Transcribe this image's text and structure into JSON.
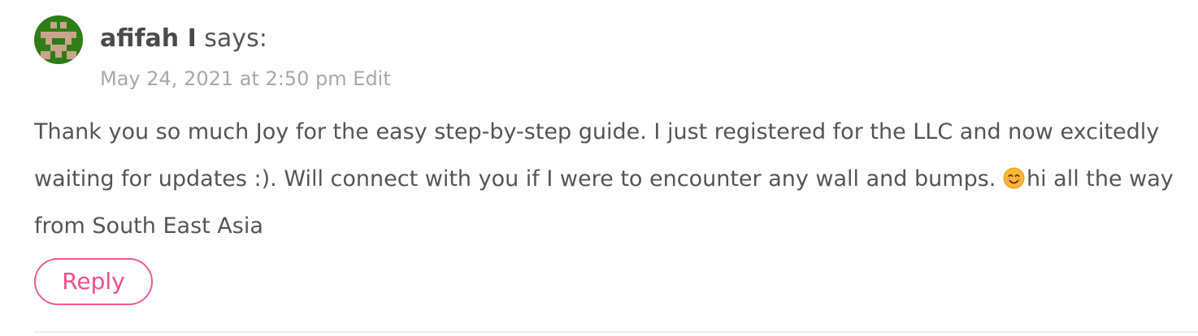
{
  "comment": {
    "author": "afifah I",
    "says_label": "says:",
    "date": "May 24, 2021 at 2:50 pm",
    "edit_label": "Edit",
    "body_main": "Thank you so much Joy for the easy step-by-step guide. I just registered for the LLC and now excitedly waiting for updates :). Will connect with you if I were to encounter any wall and bumps. ",
    "body_tail": "hi all the way from South East Asia",
    "emoji_icon": "smiling-face-emoji",
    "reply_label": "Reply"
  },
  "colors": {
    "accent": "#ef4f8b",
    "avatar_green": "#2f7d16",
    "avatar_skin": "#c9a48c",
    "meta_gray": "#a8a8a8",
    "text": "#555555"
  }
}
